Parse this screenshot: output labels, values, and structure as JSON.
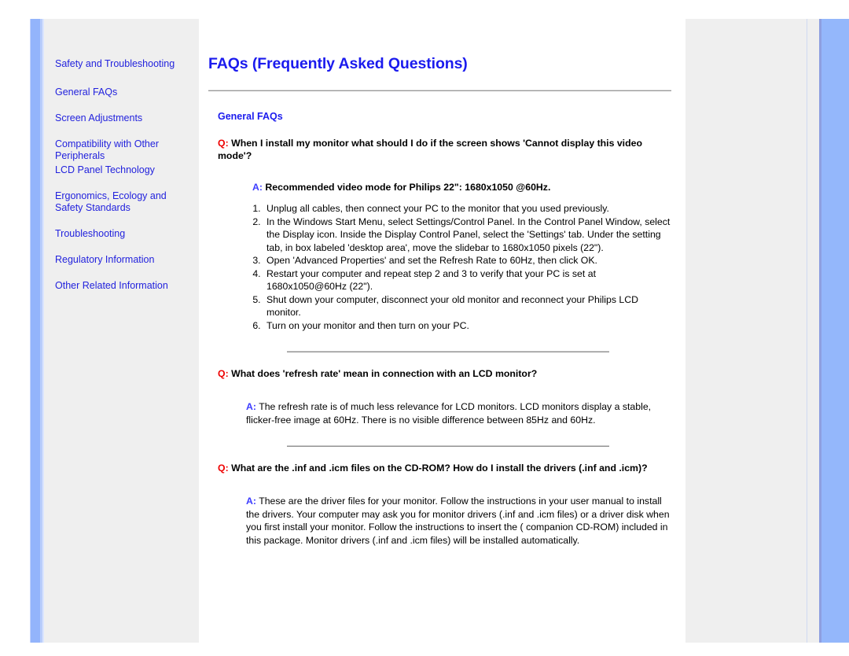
{
  "sidebar": {
    "items": [
      {
        "label": "Safety and Troubleshooting",
        "name": "safety-and-troubleshooting"
      },
      {
        "label": "General FAQs",
        "name": "general-faqs"
      },
      {
        "label": "Screen Adjustments",
        "name": "screen-adjustments"
      },
      {
        "label": "Compatibility with Other Peripherals",
        "name": "compatibility-with-other-peripherals"
      },
      {
        "label": "LCD Panel Technology",
        "name": "lcd-panel-technology"
      },
      {
        "label": "Ergonomics, Ecology and Safety Standards",
        "name": "ergonomics-ecology-and-safety-standards"
      },
      {
        "label": "Troubleshooting",
        "name": "troubleshooting"
      },
      {
        "label": "Regulatory Information",
        "name": "regulatory-information"
      },
      {
        "label": "Other Related Information",
        "name": "other-related-information"
      }
    ]
  },
  "main": {
    "title": "FAQs (Frequently Asked Questions)",
    "section_heading": "General FAQs",
    "q_prefix": "Q:",
    "a_prefix": "A:",
    "faqs": [
      {
        "question": "When I install my monitor what should I do if the screen shows 'Cannot display this video mode'?",
        "answer_bold": "Recommended video mode for Philips 22\": 1680x1050 @60Hz.",
        "steps": [
          "Unplug all cables, then connect your PC to the monitor that you used previously.",
          "In the Windows Start Menu, select Settings/Control Panel. In the Control Panel Window, select the Display icon. Inside the Display Control Panel, select the 'Settings' tab. Under the setting tab, in box labeled 'desktop area', move the slidebar to 1680x1050 pixels (22\").",
          "Open 'Advanced Properties' and set the Refresh Rate to 60Hz, then click OK.",
          "Restart your computer and repeat step 2 and 3 to verify that your PC is set at 1680x1050@60Hz (22\").",
          "Shut down your computer, disconnect your old monitor and reconnect your Philips LCD monitor.",
          "Turn on your monitor and then turn on your PC."
        ]
      },
      {
        "question": "What does 'refresh rate' mean in connection with an LCD monitor?",
        "answer": "The refresh rate is of much less relevance for LCD monitors. LCD monitors display a stable, flicker-free image at 60Hz. There is no visible difference between 85Hz and 60Hz."
      },
      {
        "question": "What are the .inf and .icm files on the CD-ROM? How do I install the drivers (.inf and .icm)?",
        "answer": "These are the driver files for your monitor. Follow the instructions in your user manual to install the drivers. Your computer may ask you for monitor drivers (.inf and .icm files) or a driver disk when you first install your monitor. Follow the instructions to insert the ( companion CD-ROM) included in this package. Monitor drivers (.inf and .icm files) will be installed automatically."
      }
    ]
  },
  "colors": {
    "link": "#2222dd",
    "title": "#1b1bee",
    "q_mark": "#ee0000",
    "a_mark": "#3c3cff",
    "panel": "#94b7fb",
    "plate": "#efefef"
  }
}
